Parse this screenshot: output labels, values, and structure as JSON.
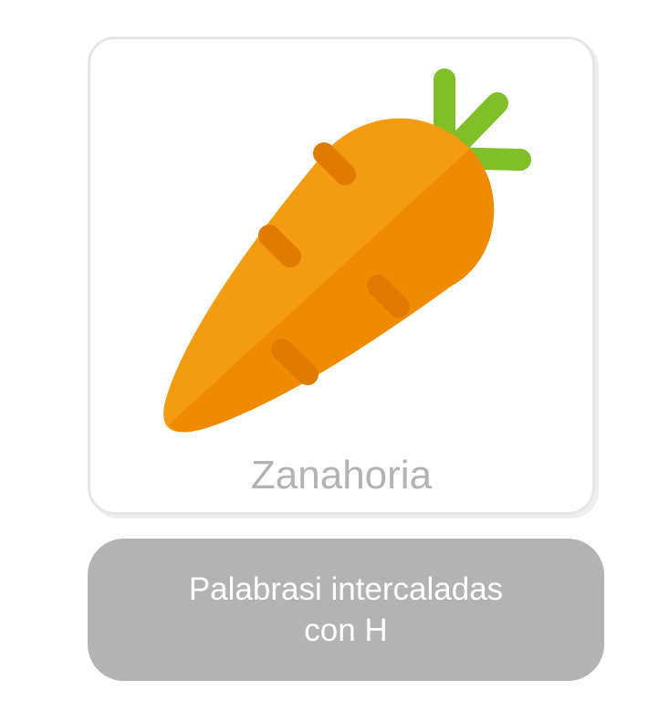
{
  "card": {
    "label": "Zanahoria",
    "image": {
      "icon": "carrot-icon",
      "colors": {
        "body_light": "#f39c12",
        "body_dark": "#f08a00",
        "ridge": "#e07a00",
        "leaf": "#7fbf27"
      }
    }
  },
  "banner": {
    "line1": "Palabrasi intercaladas",
    "line2": "con H"
  },
  "colors": {
    "label_gray": "#b3b3b3",
    "banner_bg": "#b3b3b3",
    "banner_text": "#ffffff"
  }
}
